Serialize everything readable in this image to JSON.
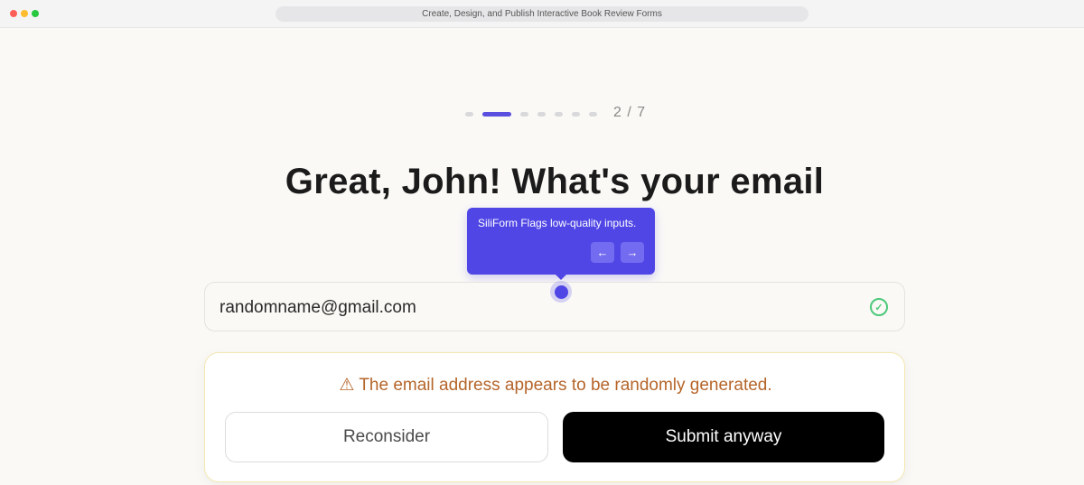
{
  "window": {
    "title": "Create, Design, and Publish Interactive Book Review Forms"
  },
  "progress": {
    "current": 2,
    "total": 7,
    "label": "2 / 7"
  },
  "question": {
    "title": "Great, John! What's your email"
  },
  "tooltip": {
    "text": "SiliForm Flags low-quality inputs.",
    "prev_icon": "arrow-left-icon",
    "next_icon": "arrow-right-icon",
    "prev_glyph": "←",
    "next_glyph": "→"
  },
  "email_field": {
    "value": "randomname@gmail.com",
    "status_icon": "check-circle-icon",
    "status_glyph": "✓"
  },
  "warning": {
    "text": "⚠ The email address appears to be randomly generated.",
    "reconsider_label": "Reconsider",
    "submit_label": "Submit anyway"
  },
  "colors": {
    "accent": "#4f46e5",
    "warning_text": "#b5652a",
    "success": "#4cc97a",
    "background": "#faf9f6"
  }
}
